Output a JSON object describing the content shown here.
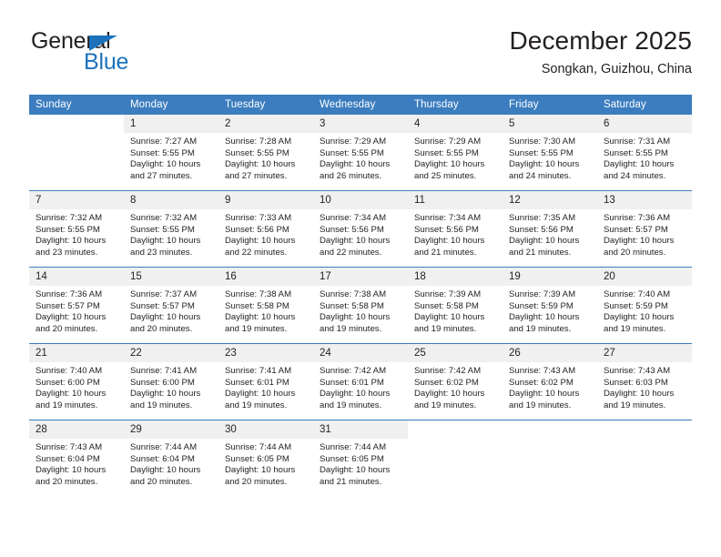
{
  "logo": {
    "word1": "General",
    "word2": "Blue",
    "accent_color": "#1b72bb"
  },
  "header": {
    "title": "December 2025",
    "subtitle": "Songkan, Guizhou, China"
  },
  "theme": {
    "header_blue": "#3b7dbf",
    "daynum_gray": "#f0f0f0",
    "text": "#231f20"
  },
  "weekday_headers": [
    "Sunday",
    "Monday",
    "Tuesday",
    "Wednesday",
    "Thursday",
    "Friday",
    "Saturday"
  ],
  "labels": {
    "sunrise_prefix": "Sunrise:",
    "sunset_prefix": "Sunset:",
    "daylight_prefix": "Daylight:"
  },
  "weeks": [
    [
      {
        "day": "",
        "sunrise": "",
        "sunset": "",
        "daylight1": "",
        "daylight2": "",
        "blank": true
      },
      {
        "day": "1",
        "sunrise": "Sunrise: 7:27 AM",
        "sunset": "Sunset: 5:55 PM",
        "daylight1": "Daylight: 10 hours",
        "daylight2": "and 27 minutes."
      },
      {
        "day": "2",
        "sunrise": "Sunrise: 7:28 AM",
        "sunset": "Sunset: 5:55 PM",
        "daylight1": "Daylight: 10 hours",
        "daylight2": "and 27 minutes."
      },
      {
        "day": "3",
        "sunrise": "Sunrise: 7:29 AM",
        "sunset": "Sunset: 5:55 PM",
        "daylight1": "Daylight: 10 hours",
        "daylight2": "and 26 minutes."
      },
      {
        "day": "4",
        "sunrise": "Sunrise: 7:29 AM",
        "sunset": "Sunset: 5:55 PM",
        "daylight1": "Daylight: 10 hours",
        "daylight2": "and 25 minutes."
      },
      {
        "day": "5",
        "sunrise": "Sunrise: 7:30 AM",
        "sunset": "Sunset: 5:55 PM",
        "daylight1": "Daylight: 10 hours",
        "daylight2": "and 24 minutes."
      },
      {
        "day": "6",
        "sunrise": "Sunrise: 7:31 AM",
        "sunset": "Sunset: 5:55 PM",
        "daylight1": "Daylight: 10 hours",
        "daylight2": "and 24 minutes."
      }
    ],
    [
      {
        "day": "7",
        "sunrise": "Sunrise: 7:32 AM",
        "sunset": "Sunset: 5:55 PM",
        "daylight1": "Daylight: 10 hours",
        "daylight2": "and 23 minutes."
      },
      {
        "day": "8",
        "sunrise": "Sunrise: 7:32 AM",
        "sunset": "Sunset: 5:55 PM",
        "daylight1": "Daylight: 10 hours",
        "daylight2": "and 23 minutes."
      },
      {
        "day": "9",
        "sunrise": "Sunrise: 7:33 AM",
        "sunset": "Sunset: 5:56 PM",
        "daylight1": "Daylight: 10 hours",
        "daylight2": "and 22 minutes."
      },
      {
        "day": "10",
        "sunrise": "Sunrise: 7:34 AM",
        "sunset": "Sunset: 5:56 PM",
        "daylight1": "Daylight: 10 hours",
        "daylight2": "and 22 minutes."
      },
      {
        "day": "11",
        "sunrise": "Sunrise: 7:34 AM",
        "sunset": "Sunset: 5:56 PM",
        "daylight1": "Daylight: 10 hours",
        "daylight2": "and 21 minutes."
      },
      {
        "day": "12",
        "sunrise": "Sunrise: 7:35 AM",
        "sunset": "Sunset: 5:56 PM",
        "daylight1": "Daylight: 10 hours",
        "daylight2": "and 21 minutes."
      },
      {
        "day": "13",
        "sunrise": "Sunrise: 7:36 AM",
        "sunset": "Sunset: 5:57 PM",
        "daylight1": "Daylight: 10 hours",
        "daylight2": "and 20 minutes."
      }
    ],
    [
      {
        "day": "14",
        "sunrise": "Sunrise: 7:36 AM",
        "sunset": "Sunset: 5:57 PM",
        "daylight1": "Daylight: 10 hours",
        "daylight2": "and 20 minutes."
      },
      {
        "day": "15",
        "sunrise": "Sunrise: 7:37 AM",
        "sunset": "Sunset: 5:57 PM",
        "daylight1": "Daylight: 10 hours",
        "daylight2": "and 20 minutes."
      },
      {
        "day": "16",
        "sunrise": "Sunrise: 7:38 AM",
        "sunset": "Sunset: 5:58 PM",
        "daylight1": "Daylight: 10 hours",
        "daylight2": "and 19 minutes."
      },
      {
        "day": "17",
        "sunrise": "Sunrise: 7:38 AM",
        "sunset": "Sunset: 5:58 PM",
        "daylight1": "Daylight: 10 hours",
        "daylight2": "and 19 minutes."
      },
      {
        "day": "18",
        "sunrise": "Sunrise: 7:39 AM",
        "sunset": "Sunset: 5:58 PM",
        "daylight1": "Daylight: 10 hours",
        "daylight2": "and 19 minutes."
      },
      {
        "day": "19",
        "sunrise": "Sunrise: 7:39 AM",
        "sunset": "Sunset: 5:59 PM",
        "daylight1": "Daylight: 10 hours",
        "daylight2": "and 19 minutes."
      },
      {
        "day": "20",
        "sunrise": "Sunrise: 7:40 AM",
        "sunset": "Sunset: 5:59 PM",
        "daylight1": "Daylight: 10 hours",
        "daylight2": "and 19 minutes."
      }
    ],
    [
      {
        "day": "21",
        "sunrise": "Sunrise: 7:40 AM",
        "sunset": "Sunset: 6:00 PM",
        "daylight1": "Daylight: 10 hours",
        "daylight2": "and 19 minutes."
      },
      {
        "day": "22",
        "sunrise": "Sunrise: 7:41 AM",
        "sunset": "Sunset: 6:00 PM",
        "daylight1": "Daylight: 10 hours",
        "daylight2": "and 19 minutes."
      },
      {
        "day": "23",
        "sunrise": "Sunrise: 7:41 AM",
        "sunset": "Sunset: 6:01 PM",
        "daylight1": "Daylight: 10 hours",
        "daylight2": "and 19 minutes."
      },
      {
        "day": "24",
        "sunrise": "Sunrise: 7:42 AM",
        "sunset": "Sunset: 6:01 PM",
        "daylight1": "Daylight: 10 hours",
        "daylight2": "and 19 minutes."
      },
      {
        "day": "25",
        "sunrise": "Sunrise: 7:42 AM",
        "sunset": "Sunset: 6:02 PM",
        "daylight1": "Daylight: 10 hours",
        "daylight2": "and 19 minutes."
      },
      {
        "day": "26",
        "sunrise": "Sunrise: 7:43 AM",
        "sunset": "Sunset: 6:02 PM",
        "daylight1": "Daylight: 10 hours",
        "daylight2": "and 19 minutes."
      },
      {
        "day": "27",
        "sunrise": "Sunrise: 7:43 AM",
        "sunset": "Sunset: 6:03 PM",
        "daylight1": "Daylight: 10 hours",
        "daylight2": "and 19 minutes."
      }
    ],
    [
      {
        "day": "28",
        "sunrise": "Sunrise: 7:43 AM",
        "sunset": "Sunset: 6:04 PM",
        "daylight1": "Daylight: 10 hours",
        "daylight2": "and 20 minutes."
      },
      {
        "day": "29",
        "sunrise": "Sunrise: 7:44 AM",
        "sunset": "Sunset: 6:04 PM",
        "daylight1": "Daylight: 10 hours",
        "daylight2": "and 20 minutes."
      },
      {
        "day": "30",
        "sunrise": "Sunrise: 7:44 AM",
        "sunset": "Sunset: 6:05 PM",
        "daylight1": "Daylight: 10 hours",
        "daylight2": "and 20 minutes."
      },
      {
        "day": "31",
        "sunrise": "Sunrise: 7:44 AM",
        "sunset": "Sunset: 6:05 PM",
        "daylight1": "Daylight: 10 hours",
        "daylight2": "and 21 minutes."
      },
      {
        "day": "",
        "sunrise": "",
        "sunset": "",
        "daylight1": "",
        "daylight2": "",
        "blank": true
      },
      {
        "day": "",
        "sunrise": "",
        "sunset": "",
        "daylight1": "",
        "daylight2": "",
        "blank": true
      },
      {
        "day": "",
        "sunrise": "",
        "sunset": "",
        "daylight1": "",
        "daylight2": "",
        "blank": true
      }
    ]
  ]
}
